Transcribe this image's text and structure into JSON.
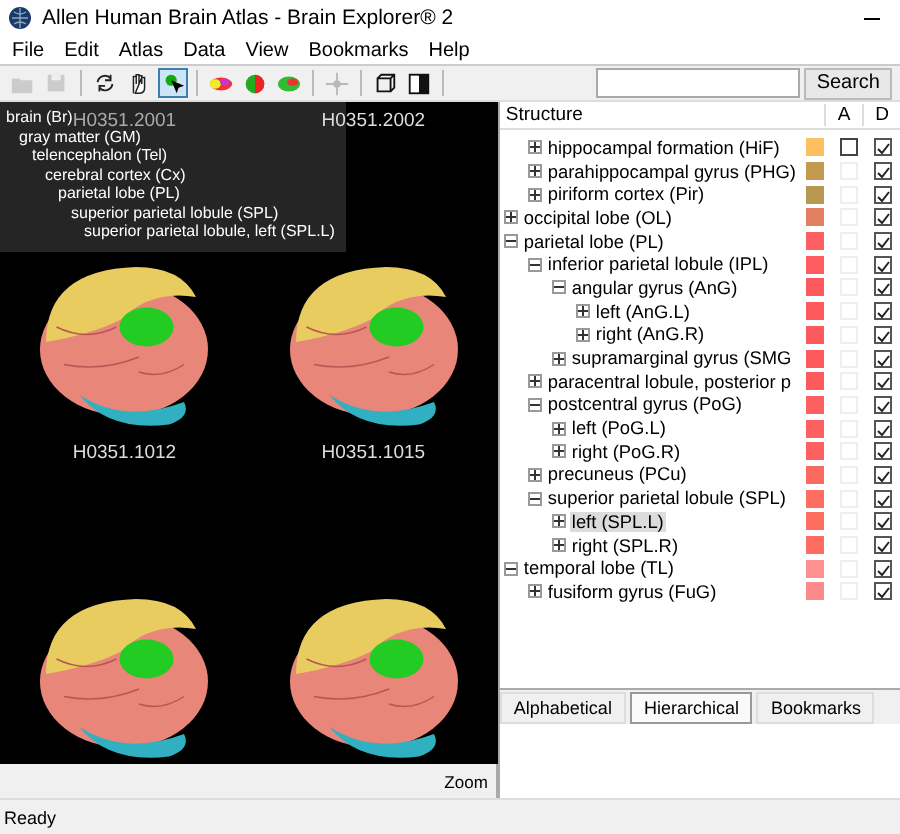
{
  "window": {
    "title": "Allen Human Brain Atlas - Brain Explorer® 2"
  },
  "menu": [
    "File",
    "Edit",
    "Atlas",
    "Data",
    "View",
    "Bookmarks",
    "Help"
  ],
  "toolbar": [
    {
      "kind": "open",
      "disabled": true,
      "selected": false
    },
    {
      "kind": "save",
      "disabled": true,
      "selected": false
    },
    {
      "kind": "rotate",
      "disabled": false,
      "selected": false
    },
    {
      "kind": "hand",
      "disabled": false,
      "selected": false
    },
    {
      "kind": "pointer",
      "disabled": false,
      "selected": true
    },
    {
      "kind": "brain-a",
      "disabled": false,
      "selected": false
    },
    {
      "kind": "brain-b",
      "disabled": false,
      "selected": false
    },
    {
      "kind": "brain-c",
      "disabled": false,
      "selected": false
    },
    {
      "kind": "move",
      "disabled": true,
      "selected": false
    },
    {
      "kind": "cube",
      "disabled": false,
      "selected": false
    },
    {
      "kind": "panel",
      "disabled": false,
      "selected": false
    }
  ],
  "search": {
    "button": "Search"
  },
  "viewports": [
    {
      "label": "H0351.2001"
    },
    {
      "label": "H0351.2002"
    },
    {
      "label": "H0351.1012"
    },
    {
      "label": "H0351.1015"
    }
  ],
  "breadcrumb": {
    "label": "brain (Br)",
    "children": [
      {
        "label": "gray matter (GM)",
        "children": [
          {
            "label": "telencephalon (Tel)",
            "children": [
              {
                "label": "cerebral cortex (Cx)",
                "children": [
                  {
                    "label": "parietal lobe (PL)",
                    "children": [
                      {
                        "label": "superior parietal lobule (SPL)",
                        "children": [
                          {
                            "label": "superior parietal lobule, left (SPL.L)"
                          }
                        ]
                      }
                    ]
                  }
                ]
              }
            ]
          }
        ]
      }
    ]
  },
  "zoom_label": "Zoom",
  "structure": {
    "columns": [
      "Structure",
      "A",
      "D"
    ],
    "tree": [
      {
        "kind": "continuation",
        "children": [
          {
            "label": "hippocampal formation (HiF)",
            "color": "#fdc060",
            "a_checked": false,
            "a_disabled": false,
            "d_checked": true,
            "expanded": false,
            "selected": false
          },
          {
            "label": "parahippocampal gyrus (PHG)",
            "color": "#c29a50",
            "a_checked": false,
            "a_disabled": true,
            "d_checked": true,
            "expanded": false,
            "selected": false
          },
          {
            "label": "piriform cortex (Pir)",
            "color": "#b89850",
            "a_checked": false,
            "a_disabled": true,
            "d_checked": true,
            "expanded": false,
            "selected": false
          }
        ]
      },
      {
        "kind": "node",
        "label": "occipital lobe (OL)",
        "color": "#e08060",
        "a_checked": false,
        "a_disabled": true,
        "d_checked": true,
        "expanded": false,
        "selected": false
      },
      {
        "kind": "node",
        "label": "parietal lobe (PL)",
        "color": "#fd6060",
        "a_checked": false,
        "a_disabled": true,
        "d_checked": true,
        "expanded": true,
        "selected": false,
        "children": [
          {
            "label": "inferior parietal lobule (IPL)",
            "color": "#fd5c60",
            "a_checked": false,
            "a_disabled": true,
            "d_checked": true,
            "expanded": true,
            "selected": false,
            "children": [
              {
                "label": "angular gyrus (AnG)",
                "color": "#fd5a5e",
                "a_checked": false,
                "a_disabled": true,
                "d_checked": true,
                "expanded": true,
                "selected": false,
                "children": [
                  {
                    "label": "left (AnG.L)",
                    "color": "#fd5a5e",
                    "a_checked": false,
                    "a_disabled": true,
                    "d_checked": true,
                    "expanded": false,
                    "selected": false
                  },
                  {
                    "label": "right (AnG.R)",
                    "color": "#fd5a5e",
                    "a_checked": false,
                    "a_disabled": true,
                    "d_checked": true,
                    "expanded": false,
                    "selected": false
                  }
                ]
              },
              {
                "label": "supramarginal gyrus (SMG",
                "color": "#fd5a5e",
                "a_checked": false,
                "a_disabled": true,
                "d_checked": true,
                "expanded": false,
                "selected": false
              }
            ]
          },
          {
            "label": "paracentral lobule, posterior p",
            "color": "#fd5a5e",
            "a_checked": false,
            "a_disabled": true,
            "d_checked": true,
            "expanded": false,
            "selected": false
          },
          {
            "label": "postcentral gyrus (PoG)",
            "color": "#fd6060",
            "a_checked": false,
            "a_disabled": true,
            "d_checked": true,
            "expanded": true,
            "selected": false,
            "children": [
              {
                "label": "left (PoG.L)",
                "color": "#fd6060",
                "a_checked": false,
                "a_disabled": true,
                "d_checked": true,
                "expanded": false,
                "selected": false
              },
              {
                "label": "right (PoG.R)",
                "color": "#fd6060",
                "a_checked": false,
                "a_disabled": true,
                "d_checked": true,
                "expanded": false,
                "selected": false
              }
            ]
          },
          {
            "label": "precuneus (PCu)",
            "color": "#fb6a60",
            "a_checked": false,
            "a_disabled": true,
            "d_checked": true,
            "expanded": false,
            "selected": false
          },
          {
            "label": "superior parietal lobule (SPL)",
            "color": "#fd6e60",
            "a_checked": false,
            "a_disabled": true,
            "d_checked": true,
            "expanded": true,
            "selected": false,
            "children": [
              {
                "label": "left (SPL.L)",
                "color": "#fd6e60",
                "a_checked": false,
                "a_disabled": true,
                "d_checked": true,
                "expanded": false,
                "selected": true
              },
              {
                "label": "right (SPL.R)",
                "color": "#fd6e60",
                "a_checked": false,
                "a_disabled": true,
                "d_checked": true,
                "expanded": false,
                "selected": false
              }
            ]
          }
        ]
      },
      {
        "kind": "node",
        "label": "temporal lobe (TL)",
        "color": "#fd9090",
        "a_checked": false,
        "a_disabled": true,
        "d_checked": true,
        "expanded": true,
        "selected": false,
        "children": [
          {
            "label": "fusiform gyrus (FuG)",
            "color": "#fd8a8a",
            "a_checked": false,
            "a_disabled": true,
            "d_checked": true,
            "expanded": false,
            "selected": false
          }
        ]
      }
    ]
  },
  "tabs": [
    {
      "label": "Alphabetical",
      "selected": false
    },
    {
      "label": "Hierarchical",
      "selected": true
    },
    {
      "label": "Bookmarks",
      "selected": false
    }
  ],
  "status_bar": "Ready"
}
